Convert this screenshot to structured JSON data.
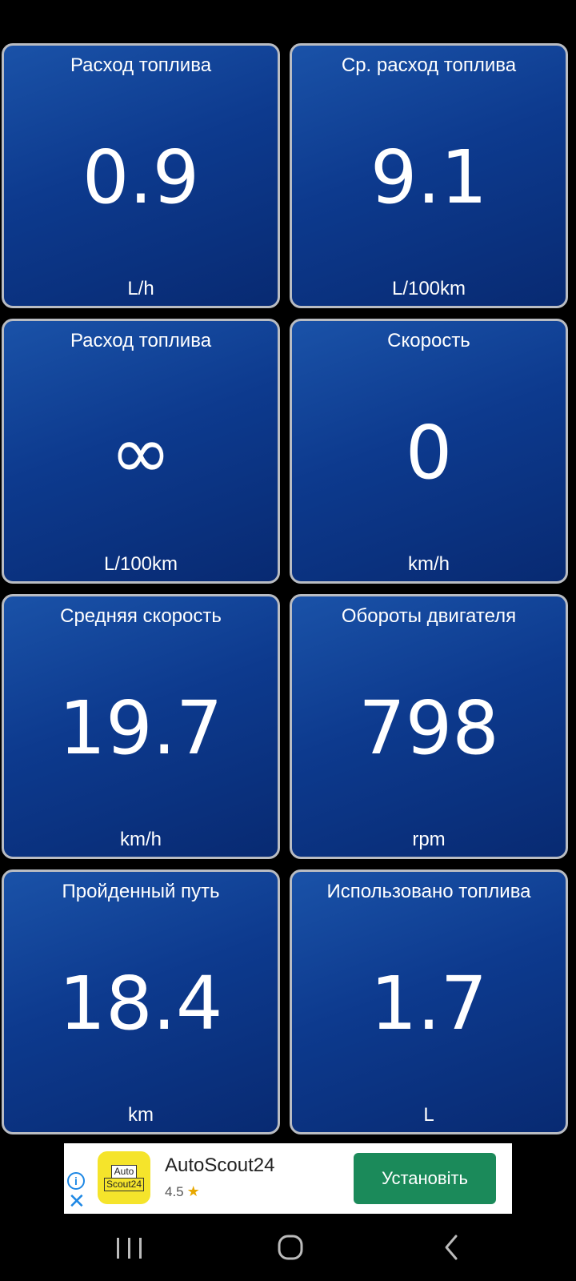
{
  "tiles": [
    {
      "label": "Расход топлива",
      "value": "0.9",
      "unit": "L/h"
    },
    {
      "label": "Ср. расход топлива",
      "value": "9.1",
      "unit": "L/100km"
    },
    {
      "label": "Расход топлива",
      "value": "∞",
      "unit": "L/100km"
    },
    {
      "label": "Скорость",
      "value": "0",
      "unit": "km/h"
    },
    {
      "label": "Средняя скорость",
      "value": "19.7",
      "unit": "km/h"
    },
    {
      "label": "Обороты двигателя",
      "value": "798",
      "unit": "rpm"
    },
    {
      "label": "Пройденный путь",
      "value": "18.4",
      "unit": "km"
    },
    {
      "label": "Использовано топлива",
      "value": "1.7",
      "unit": "L"
    }
  ],
  "ad": {
    "logo_line1": "Auto",
    "logo_line2": "Scout24",
    "app_name": "AutoScout24",
    "rating": "4.5",
    "install_label": "Установіть",
    "icons": [
      "info-icon",
      "close-icon",
      "star-icon"
    ]
  },
  "navbar": {
    "icons": [
      "recent-apps-icon",
      "home-icon",
      "back-icon"
    ]
  },
  "colors": {
    "tile_top": "#1a52a8",
    "tile_bottom": "#082a72",
    "tile_border": "#b9bcc2",
    "install_button": "#1b8a5a",
    "logo_yellow": "#f5e42b"
  }
}
